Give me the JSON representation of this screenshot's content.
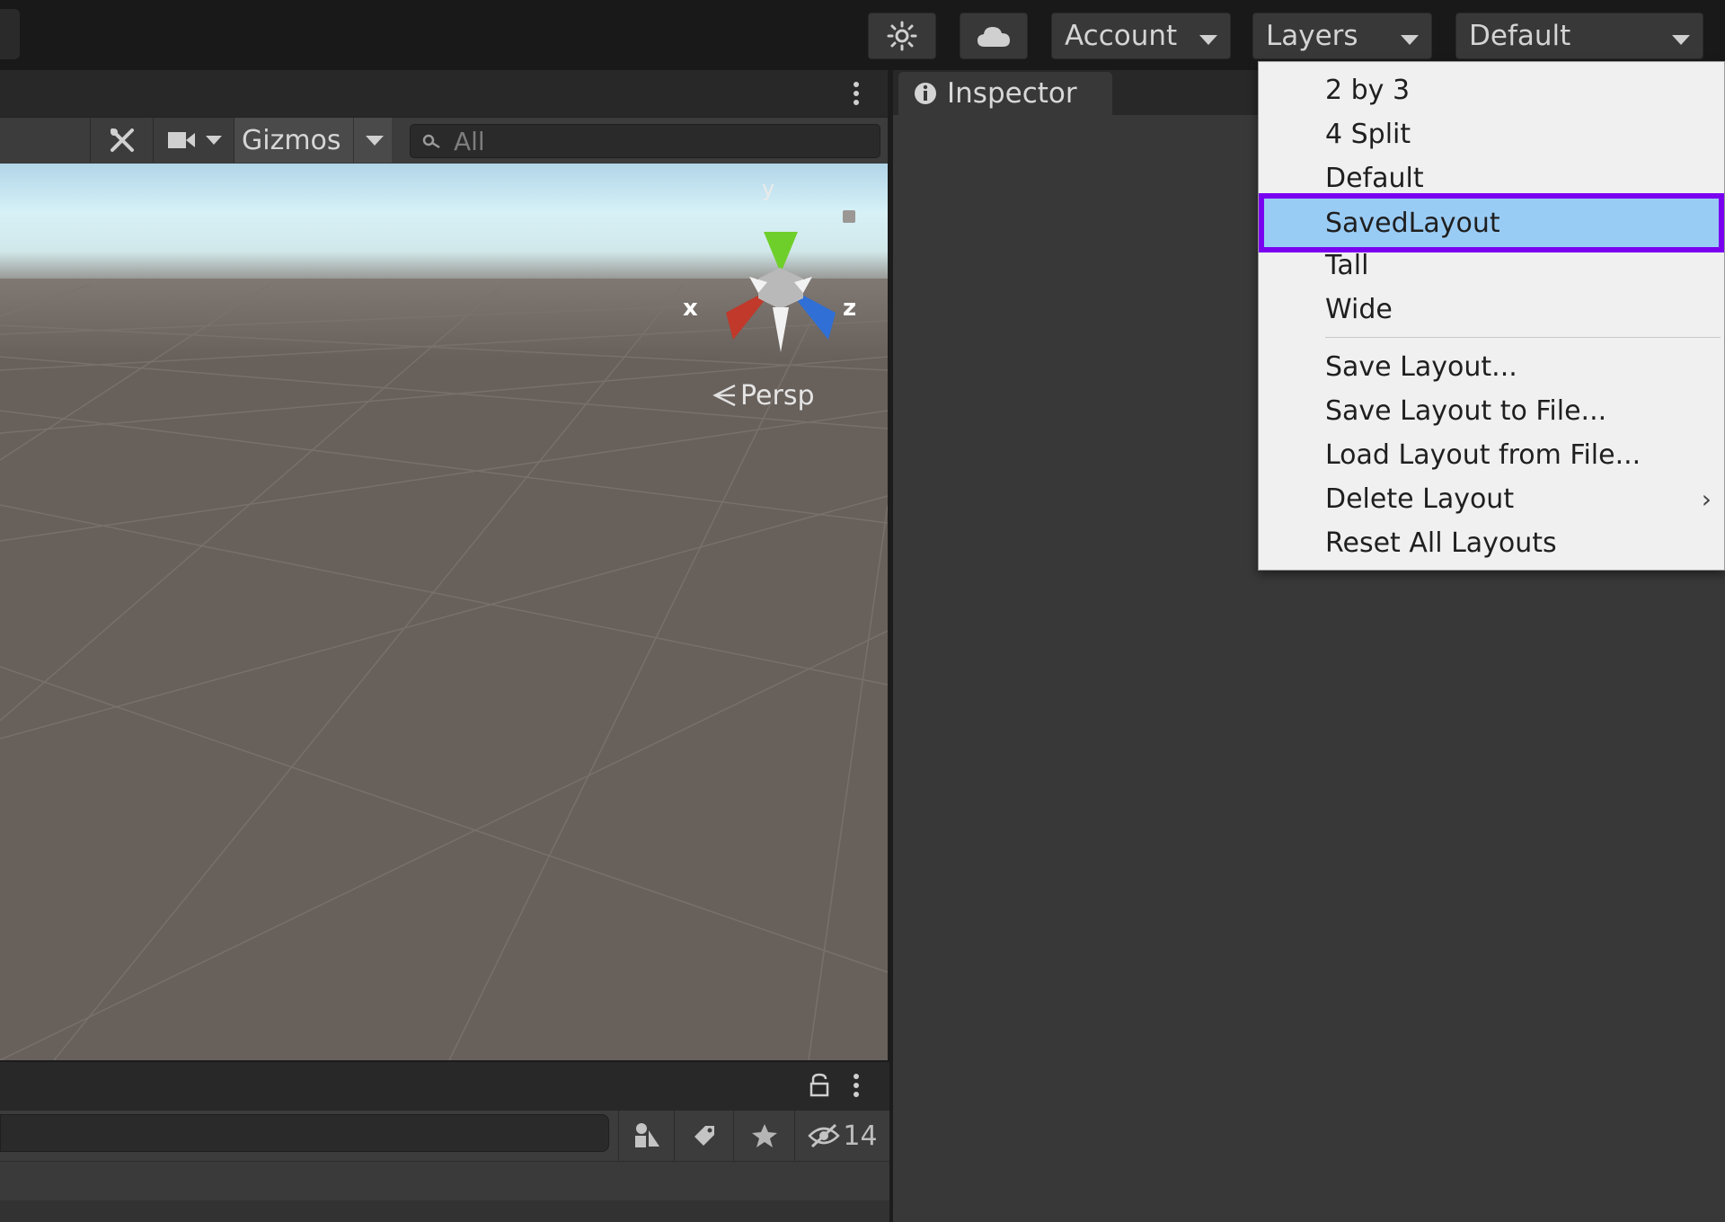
{
  "toolbar": {
    "account_label": "Account",
    "layers_label": "Layers",
    "layout_label": "Default",
    "icons": {
      "services": "sun-gear-icon",
      "cloud": "cloud-icon"
    }
  },
  "scene": {
    "toolbar": {
      "gizmos_label": "Gizmos",
      "search_placeholder": "All"
    },
    "gizmo": {
      "x_label": "x",
      "y_label": "y",
      "z_label": "z",
      "projection_label": "Persp"
    }
  },
  "inspector": {
    "tab_label": "Inspector"
  },
  "project": {
    "hidden_count": "14"
  },
  "layout_menu": {
    "items": [
      {
        "label": "2 by 3"
      },
      {
        "label": "4 Split"
      },
      {
        "label": "Default"
      },
      {
        "label": "SavedLayout",
        "highlighted": true
      },
      {
        "label": "Tall"
      },
      {
        "label": "Wide"
      }
    ],
    "actions": [
      {
        "label": "Save Layout..."
      },
      {
        "label": "Save Layout to File..."
      },
      {
        "label": "Load Layout from File..."
      },
      {
        "label": "Delete Layout",
        "has_submenu": true
      },
      {
        "label": "Reset All Layouts"
      }
    ]
  },
  "colors": {
    "highlight_fill": "#99ccf5",
    "highlight_outline": "#7a00f0",
    "axis_x": "#c0392b",
    "axis_y": "#6fcf2a",
    "axis_z": "#2f6fd6"
  }
}
